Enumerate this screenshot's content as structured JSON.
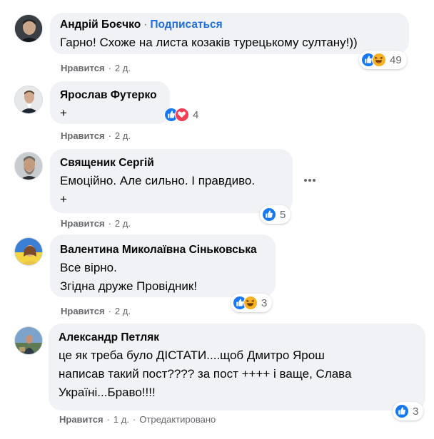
{
  "comments": [
    {
      "author": "Андрій Боєчко",
      "follow_sep": "·",
      "follow_label": "Подписаться",
      "lines": [
        "Гарно! Схоже на листа козаків турецькому султану!))"
      ],
      "reaction_count": "49",
      "reactions": [
        "like",
        "haha"
      ],
      "like_label": "Нравится",
      "time": "2 д."
    },
    {
      "author": "Ярослав Футерко",
      "lines": [
        "+"
      ],
      "reaction_count": "4",
      "reactions": [
        "like",
        "love"
      ],
      "like_label": "Нравится",
      "time": "2 д."
    },
    {
      "author": "Священик Сергій",
      "lines": [
        "Емоційно. Але сильно. І правдиво.",
        "+"
      ],
      "reaction_count": "5",
      "reactions": [
        "like"
      ],
      "like_label": "Нравится",
      "time": "2 д."
    },
    {
      "author": "Валентина Миколаївна Сіньковська",
      "lines": [
        "Все вірно.",
        "Згідна друже Провідник!"
      ],
      "reaction_count": "3",
      "reactions": [
        "like",
        "haha"
      ],
      "like_label": "Нравится",
      "time": "2 д."
    },
    {
      "author": "Александр Петляк",
      "lines": [
        "це як треба було ДІСТАТИ....щоб Дмитро Ярош",
        "написав такий пост???? за пост ++++ і ваще, Слава",
        "Україні...Браво!!!!"
      ],
      "reaction_count": "3",
      "reactions": [
        "like"
      ],
      "like_label": "Нравится",
      "time": "1 д.",
      "edited": "Отредактировано"
    }
  ],
  "colors": {
    "bubble": "#f0f2f5",
    "like": "#1877f2",
    "haha": "#f7b125",
    "love": "#f33e58",
    "link": "#216fdb",
    "meta": "#65676b"
  }
}
